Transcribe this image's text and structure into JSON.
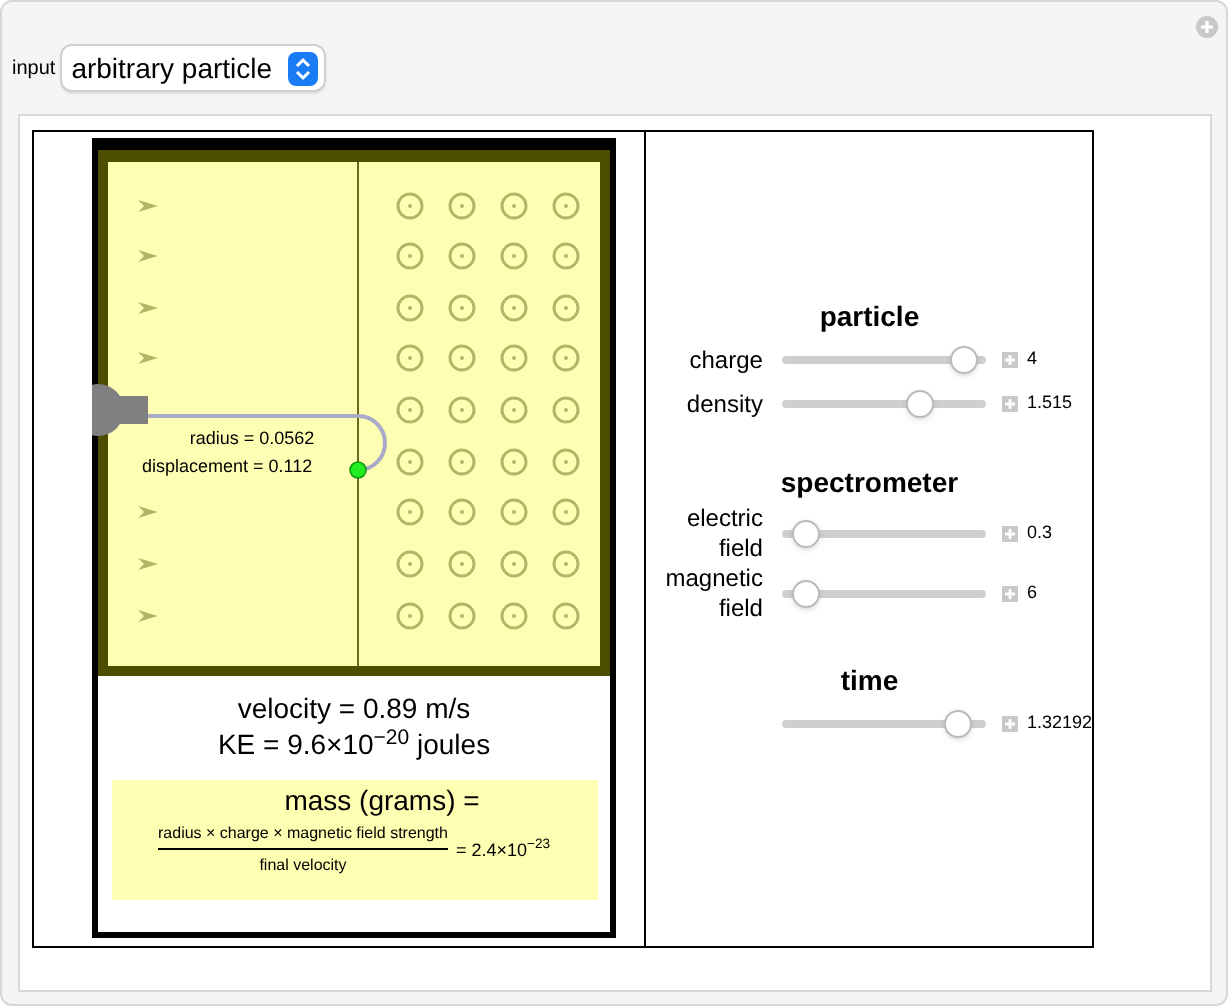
{
  "input": {
    "label": "input",
    "value": "arbitrary particle"
  },
  "diagram": {
    "radius": "radius = 0.0562",
    "displacement": "displacement = 0.112",
    "velocity": "velocity = 0.89 m/s",
    "ke": "KE = 9.6×10$^{−20}$ joules",
    "mass_title": "mass (grams) =",
    "numerator": "radius × charge × magnetic field strength",
    "denominator": "final velocity",
    "mass_value": "= 2.4×10$^{−23}$"
  },
  "panels": [
    {
      "title": "particle",
      "sliders": [
        {
          "label": "charge",
          "level": 0.95,
          "reading": "4"
        },
        {
          "label": "density",
          "level": 0.7,
          "reading": "1.515"
        }
      ]
    },
    {
      "title": "spectrometer",
      "sliders": [
        {
          "label": "electric field",
          "level": 0.05,
          "reading": "0.3"
        },
        {
          "label": "magnetic field",
          "level": 0.05,
          "reading": "6"
        }
      ]
    },
    {
      "title": "time",
      "sliders": [
        {
          "level": 0.92,
          "reading": "1.32192"
        }
      ]
    }
  ]
}
